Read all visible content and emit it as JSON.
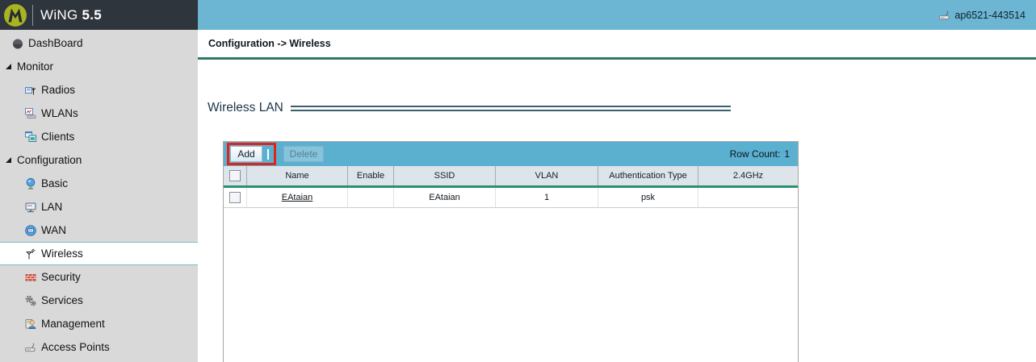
{
  "header": {
    "brand_name": "WiNG",
    "brand_version": "5.5",
    "device_name": "ap6521-443514"
  },
  "sidebar": {
    "items": [
      {
        "label": "DashBoard"
      },
      {
        "label": "Monitor"
      },
      {
        "label": "Radios"
      },
      {
        "label": "WLANs"
      },
      {
        "label": "Clients"
      },
      {
        "label": "Configuration"
      },
      {
        "label": "Basic"
      },
      {
        "label": "LAN"
      },
      {
        "label": "WAN"
      },
      {
        "label": "Wireless"
      },
      {
        "label": "Security"
      },
      {
        "label": "Services"
      },
      {
        "label": "Management"
      },
      {
        "label": "Access Points"
      }
    ]
  },
  "breadcrumb": "Configuration -> Wireless",
  "main": {
    "section_title": "Wireless LAN",
    "toolbar": {
      "add_label": "Add",
      "delete_label": "Delete",
      "row_count_label": "Row Count:",
      "row_count_value": "1"
    },
    "table": {
      "columns": [
        "Name",
        "Enable",
        "SSID",
        "VLAN",
        "Authentication Type",
        "2.4GHz"
      ],
      "rows": [
        {
          "name": "EAtaian",
          "enable": "",
          "ssid": "EAtaian",
          "vlan": "1",
          "authentication_type": "psk",
          "band_24ghz": ""
        }
      ]
    }
  },
  "colors": {
    "top_bar_dark": "#2f353c",
    "top_bar_blue": "#6cb6d4",
    "toolbar_blue": "#5bb0d0",
    "sidebar_bg": "#d9d9d9",
    "breadcrumb_rule_green": "#2d7b64",
    "table_header_rule_green": "#2a9170",
    "annotation_red": "#e2231a",
    "logo_olive": "#a8b421"
  }
}
